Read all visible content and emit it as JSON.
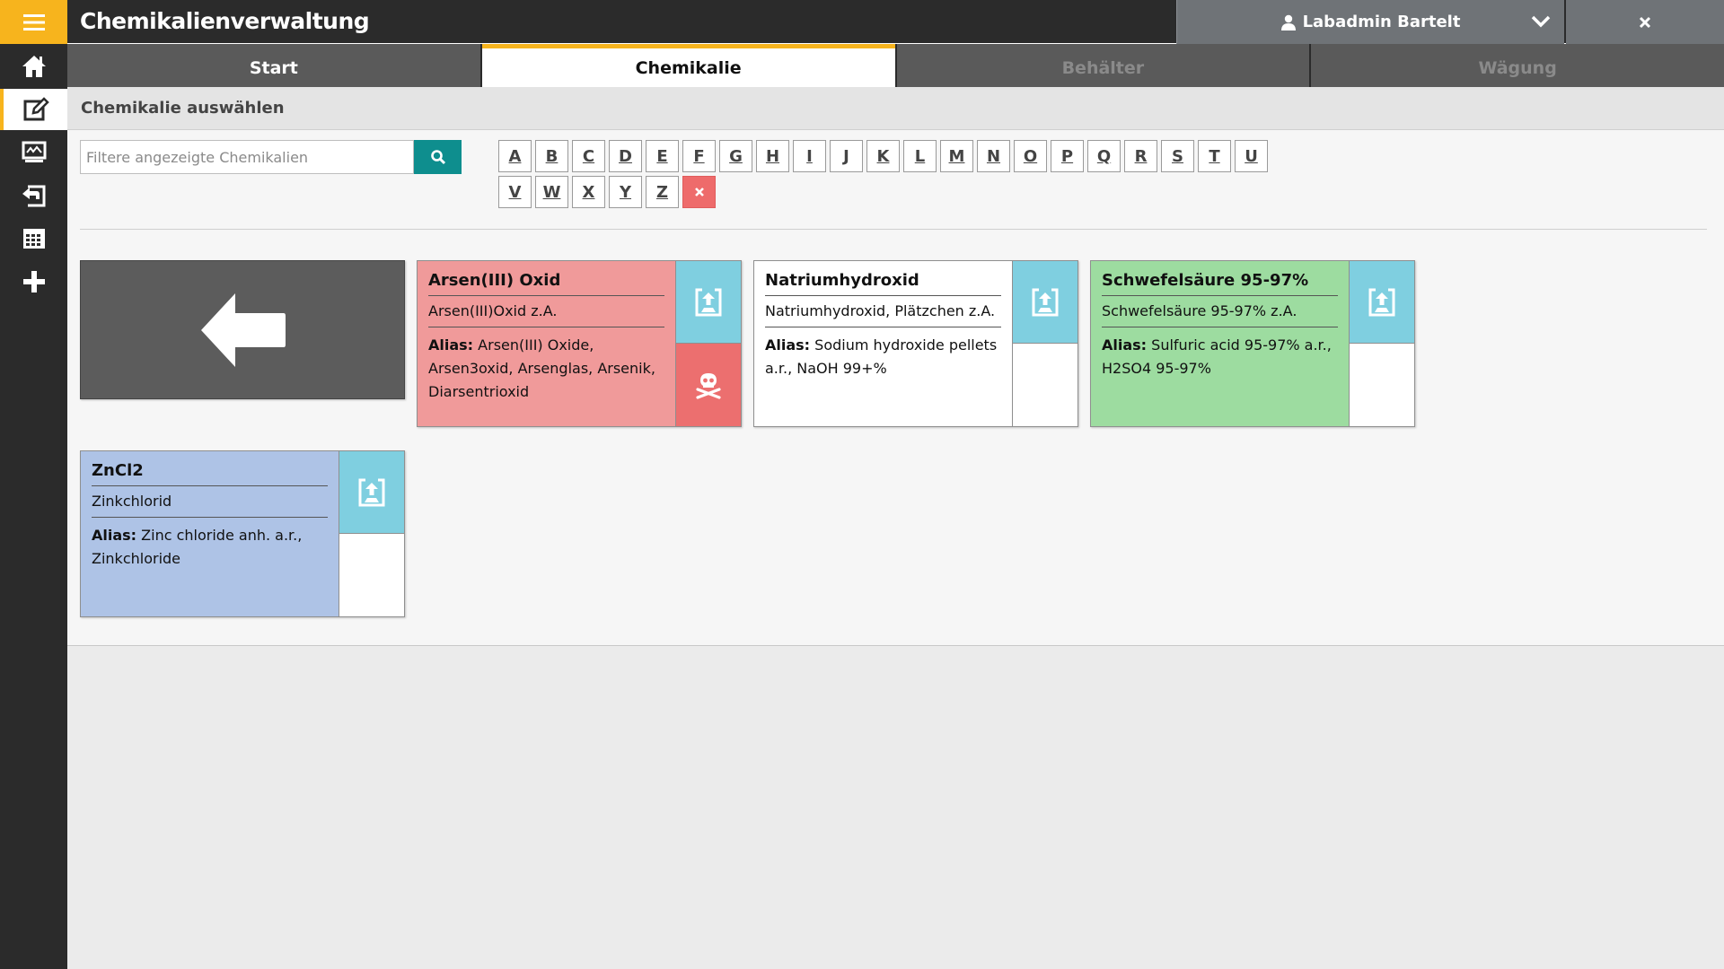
{
  "app": {
    "title": "Chemikalienverwaltung"
  },
  "header": {
    "user_name": "Labadmin Bartelt"
  },
  "sidebar": {
    "items": [
      {
        "icon": "home-icon"
      },
      {
        "icon": "edit-icon"
      },
      {
        "icon": "monitor-icon"
      },
      {
        "icon": "return-icon"
      },
      {
        "icon": "calendar-grid-icon"
      },
      {
        "icon": "plus-icon"
      }
    ]
  },
  "tabs": [
    {
      "label": "Start",
      "state": "normal"
    },
    {
      "label": "Chemikalie",
      "state": "active"
    },
    {
      "label": "Behälter",
      "state": "disabled"
    },
    {
      "label": "Wägung",
      "state": "disabled"
    }
  ],
  "section": {
    "title": "Chemikalie auswählen"
  },
  "search": {
    "placeholder": "Filtere angezeigte Chemikalien",
    "value": ""
  },
  "letters": {
    "row1": [
      "A",
      "B",
      "C",
      "D",
      "E",
      "F",
      "G",
      "H",
      "I",
      "J",
      "K",
      "L",
      "M",
      "N",
      "O",
      "P",
      "Q",
      "R",
      "S",
      "T",
      "U"
    ],
    "row2": [
      "V",
      "W",
      "X",
      "Y",
      "Z"
    ],
    "clear_symbol": "✕"
  },
  "alias_label": "Alias:",
  "chemicals": [
    {
      "name": "Arsen(III) Oxid",
      "subtitle": "Arsen(III)Oxid z.A.",
      "alias": "Arsen(III) Oxide, Arsen3oxid, Arsenglas, Arsenik, Diarsentrioxid",
      "color": "#f09a9a",
      "hazard": "skull-crossbones-icon"
    },
    {
      "name": "Natriumhydroxid",
      "subtitle": "Natriumhydroxid, Plätzchen z.A.",
      "alias": "Sodium hydroxide pellets a.r., NaOH 99+%",
      "color": "#ffffff",
      "hazard": ""
    },
    {
      "name": "Schwefelsäure 95-97%",
      "subtitle": "Schwefelsäure 95-97% z.A.",
      "alias": "Sulfuric acid 95-97% a.r., H2SO4 95-97%",
      "color": "#9ddca0",
      "hazard": ""
    },
    {
      "name": "ZnCl2",
      "subtitle": "Zinkchlorid",
      "alias": "Zinc chloride anh. a.r., Zinkchloride",
      "color": "#aec3e6",
      "hazard": ""
    }
  ],
  "colors": {
    "accent": "#f7b41d",
    "dark": "#2b2b2b",
    "teal": "#0e8e8e",
    "upload": "#7fcfe0",
    "hazard": "#ec6f6f"
  }
}
